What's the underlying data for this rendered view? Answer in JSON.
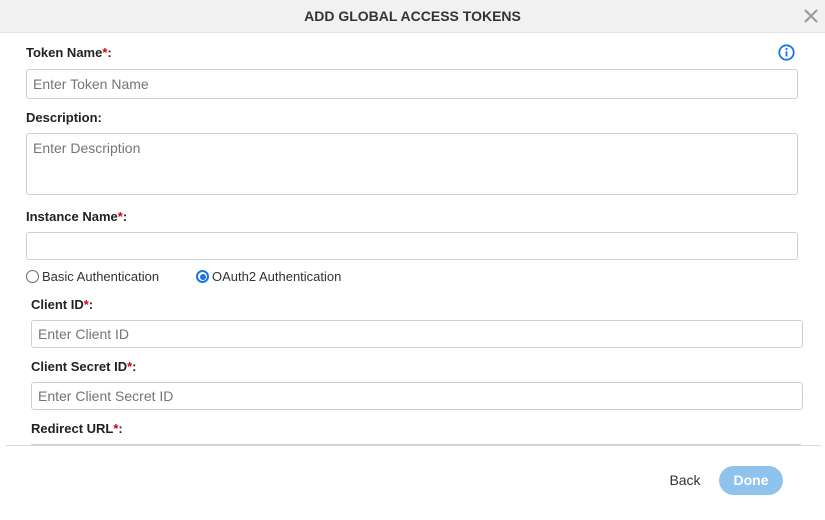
{
  "dialog": {
    "title": "ADD GLOBAL ACCESS TOKENS",
    "close_icon": "close-icon",
    "info_icon": "info-icon"
  },
  "form": {
    "token_name": {
      "label": "Token Name",
      "required_mark": "*",
      "suffix": ":",
      "placeholder": "Enter Token Name",
      "value": ""
    },
    "description": {
      "label": "Description:",
      "placeholder": "Enter Description",
      "value": ""
    },
    "instance_name": {
      "label": "Instance Name",
      "required_mark": "*",
      "suffix": ":",
      "value": ""
    },
    "auth": {
      "options": [
        {
          "label": "Basic Authentication",
          "selected": false
        },
        {
          "label": "OAuth2 Authentication",
          "selected": true
        }
      ]
    },
    "client_id": {
      "label": "Client ID",
      "required_mark": "*",
      "suffix": ":",
      "placeholder": "Enter Client ID",
      "value": ""
    },
    "client_secret": {
      "label": "Client Secret ID",
      "required_mark": "*",
      "suffix": ":",
      "placeholder": "Enter Client Secret ID",
      "value": ""
    },
    "redirect_url": {
      "label": "Redirect URL",
      "required_mark": "*",
      "suffix": ":"
    }
  },
  "footer": {
    "back_label": "Back",
    "done_label": "Done"
  },
  "colors": {
    "accent": "#1a73e8",
    "required": "#d0021b",
    "done_button_disabled": "#90c2ee",
    "header_bg": "#f1f1f1"
  }
}
